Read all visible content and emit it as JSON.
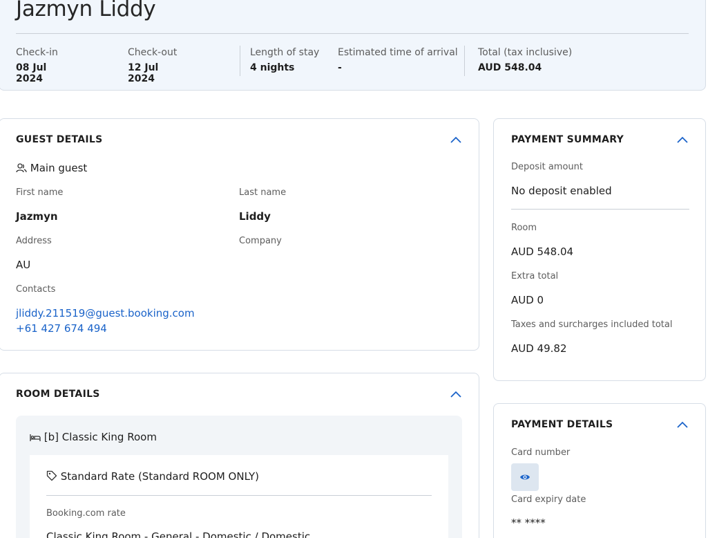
{
  "header": {
    "guest_name": "Jazmyn Liddy",
    "check_in_label": "Check-in",
    "check_in": "08 Jul 2024",
    "check_out_label": "Check-out",
    "check_out": "12 Jul 2024",
    "stay_label": "Length of stay",
    "stay": "4 nights",
    "eta_label": "Estimated time of arrival",
    "eta": "-",
    "total_label": "Total (tax inclusive)",
    "total": "AUD 548.04"
  },
  "guest_details": {
    "title": "GUEST DETAILS",
    "main_guest": "Main guest",
    "first_name_label": "First name",
    "first_name": "Jazmyn",
    "last_name_label": "Last name",
    "last_name": "Liddy",
    "address_label": "Address",
    "address": "AU",
    "company_label": "Company",
    "contacts_label": "Contacts",
    "email": "jliddy.211519@guest.booking.com",
    "phone": "+61 427 674 494"
  },
  "room_details": {
    "title": "ROOM DETAILS",
    "room_name": "[b] Classic King Room",
    "rate_name": "Standard Rate (Standard ROOM ONLY)",
    "booking_rate_label": "Booking.com rate",
    "booking_rate_value": "Classic King Room - General - Domestic / Domestic"
  },
  "payment_summary": {
    "title": "PAYMENT SUMMARY",
    "deposit_label": "Deposit amount",
    "deposit_value": "No deposit enabled",
    "room_label": "Room",
    "room_value": "AUD 548.04",
    "extra_label": "Extra total",
    "extra_value": "AUD 0",
    "taxes_label": "Taxes and surcharges included total",
    "taxes_value": "AUD 49.82"
  },
  "payment_details": {
    "title": "PAYMENT DETAILS",
    "card_number_label": "Card number",
    "card_expiry_label": "Card expiry date",
    "card_expiry_value": "** ****"
  },
  "colors": {
    "accent": "#1a63c9",
    "header_bg": "#f1f6fc",
    "room_bg": "#f2f5f8"
  }
}
